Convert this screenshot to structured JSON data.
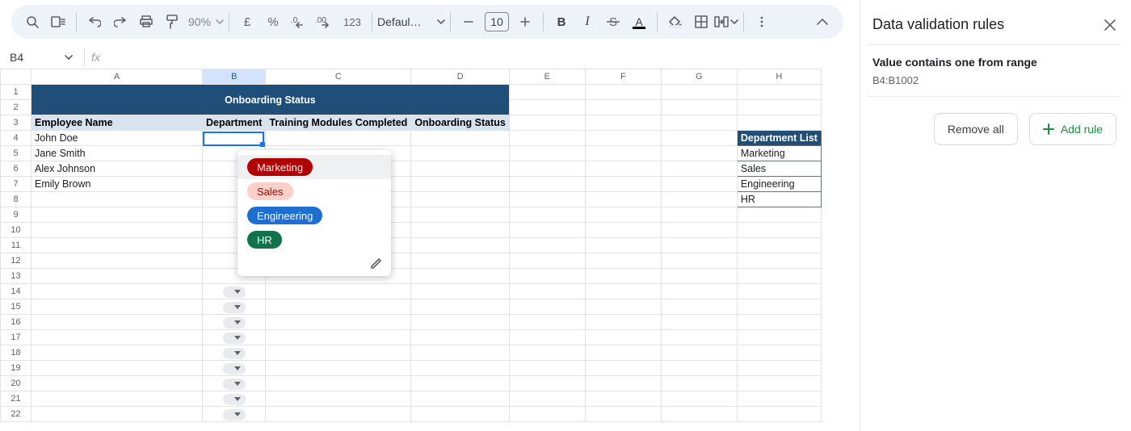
{
  "toolbar": {
    "zoom": "90%",
    "currency_symbol": "£",
    "percent": "%",
    "dec_down": ".0",
    "dec_up": ".00",
    "n123": "123",
    "font_name": "Defaul…",
    "font_size": "10",
    "bold": "B",
    "italic": "I",
    "text_a": "A"
  },
  "name_box": "B4",
  "columns": [
    "A",
    "B",
    "C",
    "D",
    "E",
    "F",
    "G",
    "H"
  ],
  "rows": [
    "1",
    "2",
    "3",
    "4",
    "5",
    "6",
    "7",
    "8",
    "9",
    "10",
    "11",
    "12",
    "13",
    "14",
    "15",
    "16",
    "17",
    "18",
    "19",
    "20",
    "21",
    "22"
  ],
  "title": "Onboarding Status",
  "headers": {
    "a": "Employee Name",
    "b": "Department",
    "c": "Training Modules Completed",
    "d": "Onboarding Status"
  },
  "employees": [
    "John Doe",
    "Jane Smith",
    "Alex Johnson",
    "Emily Brown"
  ],
  "dept_list_header": "Department List",
  "dept_list": [
    "Marketing",
    "Sales",
    "Engineering",
    "HR"
  ],
  "dropdown": {
    "options": [
      {
        "label": "Marketing",
        "cls": "red"
      },
      {
        "label": "Sales",
        "cls": "pink"
      },
      {
        "label": "Engineering",
        "cls": "blue"
      },
      {
        "label": "HR",
        "cls": "green"
      }
    ]
  },
  "side": {
    "title": "Data validation rules",
    "rule_title": "Value contains one from range",
    "rule_range": "B4:B1002",
    "remove_all": "Remove all",
    "add_rule": "Add rule"
  }
}
